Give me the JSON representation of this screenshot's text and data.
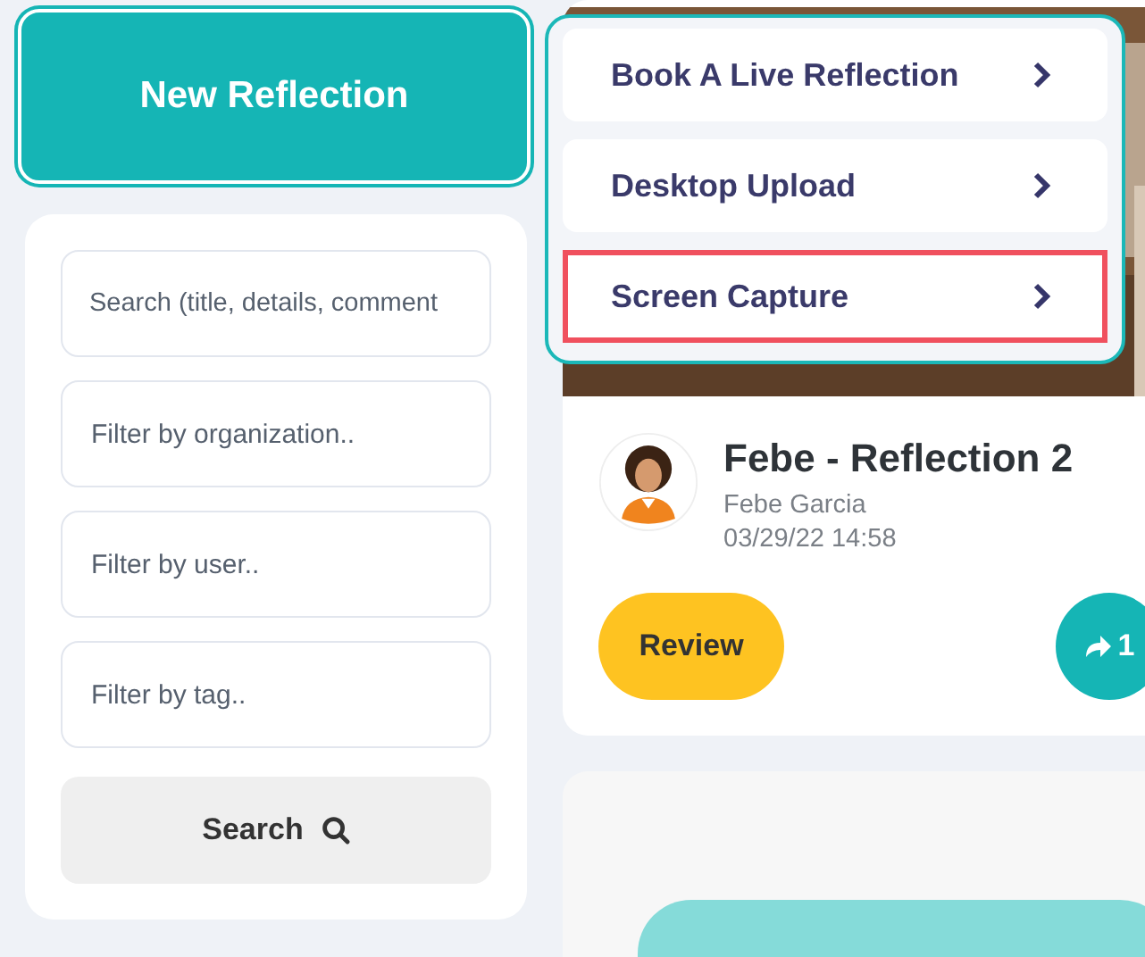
{
  "new_button": {
    "label": "New Reflection"
  },
  "filters": {
    "fields": [
      {
        "placeholder": "Search (title, details, comment"
      },
      {
        "placeholder": "Filter by organization.."
      },
      {
        "placeholder": "Filter by user.."
      },
      {
        "placeholder": "Filter by tag.."
      }
    ],
    "search_button": {
      "label": "Search"
    }
  },
  "menu": {
    "items": [
      {
        "label": "Book A Live Reflection",
        "selected": false
      },
      {
        "label": "Desktop Upload",
        "selected": false
      },
      {
        "label": "Screen Capture",
        "selected": true
      }
    ]
  },
  "cards": [
    {
      "kind": "reflection",
      "title": "Febe - Reflection 2",
      "author": "Febe Garcia",
      "date": "03/29/22 14:58",
      "review_label": "Review",
      "share_count": "1"
    },
    {
      "kind": "placeholder"
    }
  ]
}
